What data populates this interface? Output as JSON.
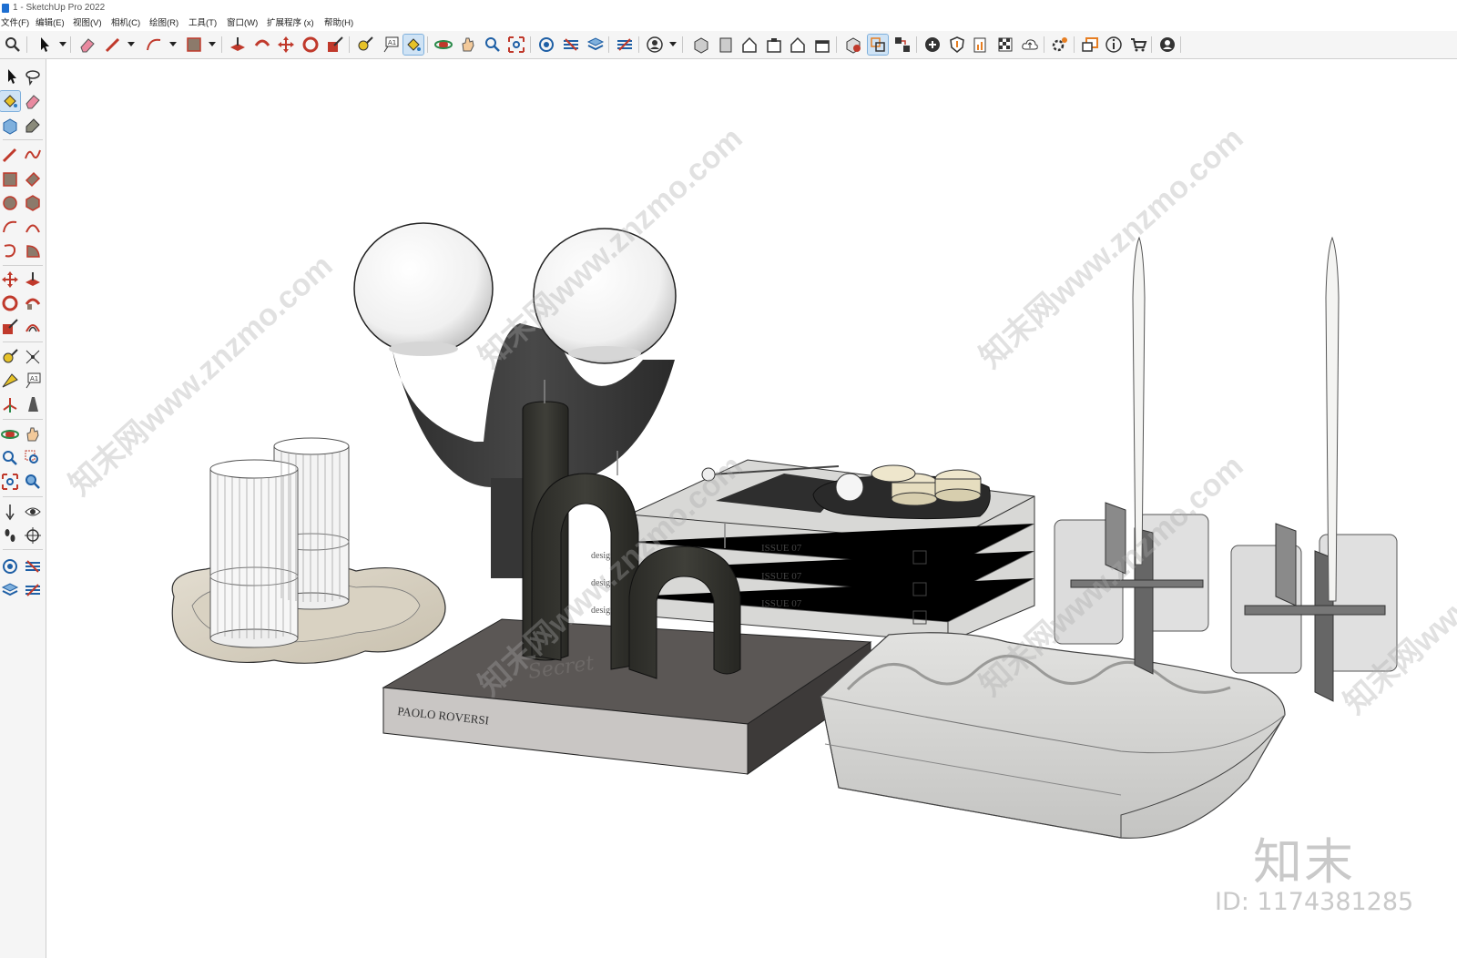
{
  "window": {
    "title": "1 - SketchUp Pro 2022"
  },
  "menu": [
    {
      "label": "文件(F)"
    },
    {
      "label": "编辑(E)"
    },
    {
      "label": "视图(V)"
    },
    {
      "label": "相机(C)"
    },
    {
      "label": "绘图(R)"
    },
    {
      "label": "工具(T)"
    },
    {
      "label": "窗口(W)"
    },
    {
      "label": "扩展程序 (x)"
    },
    {
      "label": "帮助(H)"
    }
  ],
  "scene": {
    "book_title": "PAOLO ROVERSI",
    "book_script": "Secret",
    "magazine_issue": "ISSUE 07",
    "magazine_spine": "design"
  },
  "watermark": {
    "text": "知末网www.znzmo.com",
    "logo": "知末",
    "id": "ID: 1174381285"
  },
  "colors": {
    "accent": "#1e6fd1",
    "toolbar_bg": "#f5f5f5",
    "active_tool_bg": "#cfe3f5"
  }
}
